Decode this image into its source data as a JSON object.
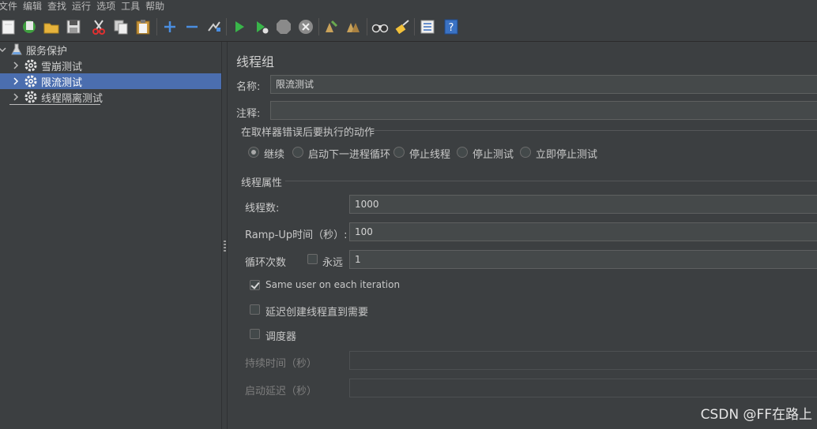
{
  "menu": [
    "文件",
    "编辑",
    "查找",
    "运行",
    "选项",
    "工具",
    "帮助"
  ],
  "toolbar": {
    "icons": [
      "new-icon",
      "templates-icon",
      "open-icon",
      "save-icon",
      "cut-icon",
      "copy-icon",
      "paste-icon",
      "expand-icon",
      "collapse-icon",
      "toggle-icon",
      "start-icon",
      "start-no-pause-icon",
      "stop-icon",
      "shutdown-icon",
      "clear-icon",
      "clear-all-icon",
      "search-icon",
      "reset-search-icon",
      "function-helper-icon",
      "help-icon"
    ]
  },
  "tree": {
    "root": "服务保护",
    "items": [
      {
        "label": "雪崩测试",
        "selected": false
      },
      {
        "label": "限流测试",
        "selected": true
      },
      {
        "label": "线程隔离测试",
        "selected": false
      }
    ]
  },
  "panel": {
    "title": "线程组",
    "name_label": "名称:",
    "name_value": "限流测试",
    "comment_label": "注释:",
    "comment_value": "",
    "error_action_title": "在取样器错误后要执行的动作",
    "error_actions": [
      {
        "label": "继续",
        "selected": true
      },
      {
        "label": "启动下一进程循环",
        "selected": false
      },
      {
        "label": "停止线程",
        "selected": false
      },
      {
        "label": "停止测试",
        "selected": false
      },
      {
        "label": "立即停止测试",
        "selected": false
      }
    ],
    "thread_props_title": "线程属性",
    "threads_label": "线程数:",
    "threads_value": "1000",
    "rampup_label": "Ramp-Up时间（秒）:",
    "rampup_value": "100",
    "loop_label": "循环次数",
    "forever_label": "永远",
    "forever_checked": false,
    "loop_value": "1",
    "same_user_label": "Same user on each iteration",
    "same_user_checked": true,
    "delay_label": "延迟创建线程直到需要",
    "delay_checked": false,
    "scheduler_label": "调度器",
    "scheduler_checked": false,
    "duration_label": "持续时间（秒）",
    "duration_value": "",
    "startup_delay_label": "启动延迟（秒）",
    "startup_delay_value": ""
  },
  "watermark": "CSDN @FF在路上"
}
